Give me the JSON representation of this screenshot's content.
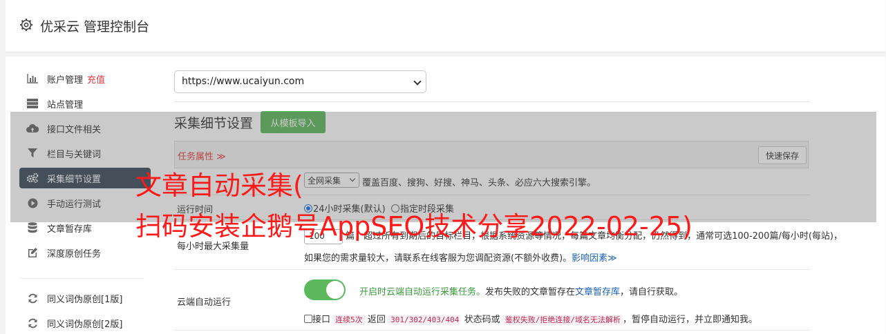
{
  "header": {
    "title": "优采云 管理控制台",
    "icon": "gear-icon"
  },
  "sidebar": {
    "items": [
      {
        "label": "账户管理",
        "extra": "充值",
        "icon": "bar-chart-icon"
      },
      {
        "label": "站点管理",
        "icon": "server-icon"
      },
      {
        "label": "接口文件相关",
        "icon": "cloud-upload-icon"
      },
      {
        "label": "栏目与关键词",
        "icon": "filter-icon"
      },
      {
        "label": "采集细节设置",
        "icon": "cogs-icon"
      },
      {
        "label": "手动运行测试",
        "icon": "play-icon"
      },
      {
        "label": "文章暂存库",
        "icon": "database-icon"
      },
      {
        "label": "深度原创任务",
        "icon": "edit-icon"
      },
      {
        "label": "同义词伪原创[1版]",
        "icon": "refresh-icon"
      },
      {
        "label": "同义词伪原创[2版]",
        "icon": "refresh-icon"
      }
    ]
  },
  "site_select": {
    "value": "https://www.ucaiyun.com"
  },
  "section": {
    "title": "采集细节设置",
    "template_button": "从模板导入"
  },
  "panel": {
    "label": "任务属性 ≫",
    "quick_save": "快速保存"
  },
  "rows": {
    "source": {
      "select_value": "全网采集",
      "desc": "覆盖百度、搜狗、好搜、神马、头条、必应六大搜索引擎。"
    },
    "runtime": {
      "label": "运行时间",
      "opt1": "24小时采集(默认)",
      "opt2": "指定时段采集"
    },
    "max_per_hour": {
      "label": "每小时最大采集量",
      "value": "100",
      "line1": "篇，超过所有到期后的目标栏目，根据系统资源等情况，每篇文章均衡分配，仍然得到，通常可选100-200篇/每小时(每站)，",
      "line2": "如果您的需求量较大，请联系在线客服为您调配资源(不额外收费)。",
      "link": "影响因素≫"
    },
    "cloud": {
      "label": "云端自动运行",
      "green_text": "开启时云端自动运行采集任务。",
      "text_mid": "发布失败的文章暂存在",
      "link": "文章暂存库",
      "text_end": "，请自行获取。",
      "line2_a": "接口",
      "code1": "连续5次",
      "line2_b": "返回",
      "code2": "301/302/403/404",
      "line2_c": "状态码或",
      "code3": "鉴权失败/拒绝连接/域名无法解析",
      "line2_d": "，暂停自动运行，并立即通知我。"
    }
  },
  "watermark": {
    "line1": "文章自动采集(",
    "line2": "扫码安装企鹅号AppSEO技术分享2022-02-25)"
  },
  "colors": {
    "accent_green": "#5cb85c",
    "sidebar_active": "#3a4b5b",
    "red": "#e4393c",
    "watermark": "#ff1a1a"
  }
}
